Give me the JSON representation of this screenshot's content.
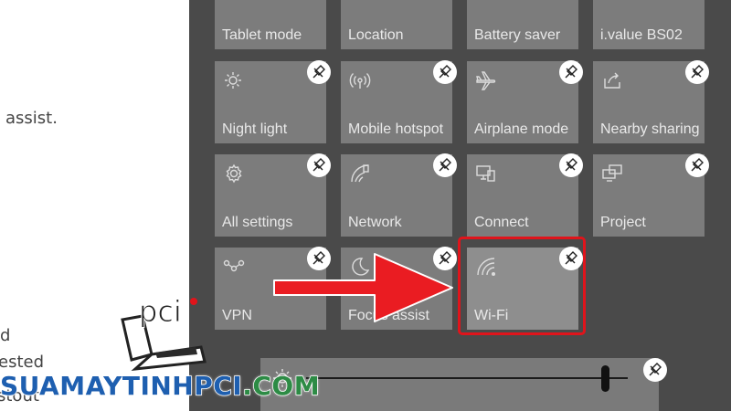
{
  "left_pane": {
    "lines": [
      "assist.",
      "d",
      "ested",
      "stout"
    ]
  },
  "tiles": [
    {
      "label": "Tablet mode",
      "icon": "tablet-mode-icon"
    },
    {
      "label": "Location",
      "icon": "location-icon"
    },
    {
      "label": "Battery saver",
      "icon": "battery-saver-icon"
    },
    {
      "label": "i.value BS02",
      "icon": "bluetooth-device-icon"
    },
    {
      "label": "Night light",
      "icon": "night-light-icon"
    },
    {
      "label": "Mobile hotspot",
      "icon": "mobile-hotspot-icon"
    },
    {
      "label": "Airplane mode",
      "icon": "airplane-icon"
    },
    {
      "label": "Nearby sharing",
      "icon": "nearby-sharing-icon"
    },
    {
      "label": "All settings",
      "icon": "gear-icon"
    },
    {
      "label": "Network",
      "icon": "network-icon"
    },
    {
      "label": "Connect",
      "icon": "connect-icon"
    },
    {
      "label": "Project",
      "icon": "project-icon"
    },
    {
      "label": "VPN",
      "icon": "vpn-icon"
    },
    {
      "label": "Focus assist",
      "icon": "moon-icon"
    },
    {
      "label": "Wi-Fi",
      "icon": "wifi-icon"
    }
  ],
  "brightness": {
    "level": 0.93,
    "icon": "sun-icon"
  },
  "colors": {
    "panel": "#4a4a4a",
    "tile": "#7c7c7c",
    "highlight": "#e0141b",
    "arrow": "#ea1c22"
  },
  "watermark": {
    "part1": "SUAMAYTINH",
    "part2": "PCI",
    "part3": ".COM",
    "logo_text": "pci"
  }
}
